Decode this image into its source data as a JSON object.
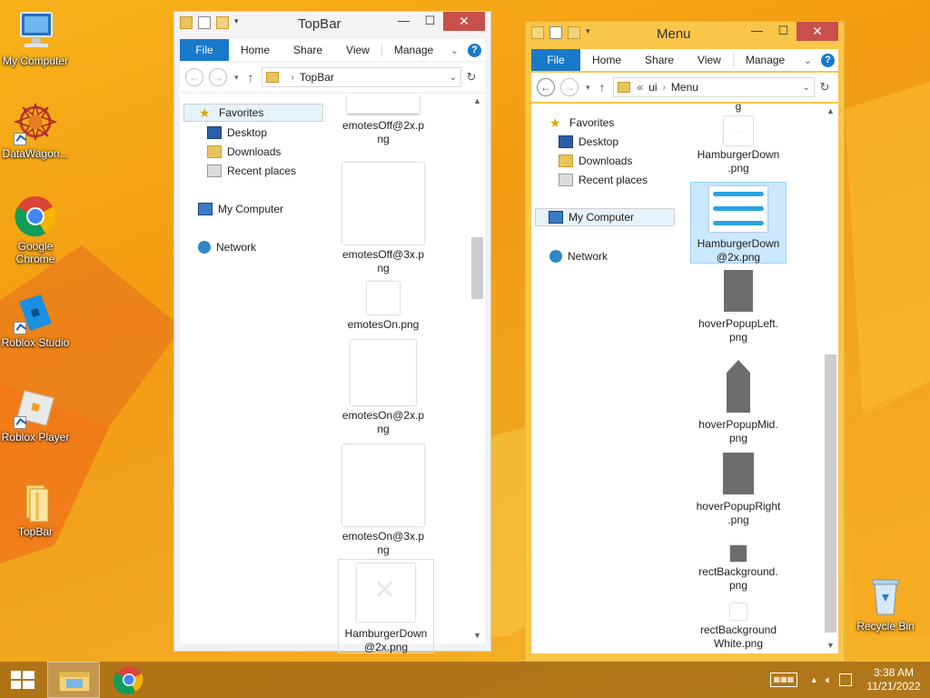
{
  "desktop": {
    "icons": [
      {
        "label": "My Computer"
      },
      {
        "label": "DataWagon..."
      },
      {
        "label": "Google Chrome"
      },
      {
        "label": "Roblox Studio"
      },
      {
        "label": "Roblox Player"
      },
      {
        "label": "TopBar"
      },
      {
        "label": "Recycle Bin"
      }
    ]
  },
  "left_window": {
    "title": "TopBar",
    "ribbon": {
      "file": "File",
      "tabs": [
        "Home",
        "Share",
        "View",
        "Manage"
      ]
    },
    "address": {
      "crumbs": [
        "TopBar"
      ]
    },
    "nav": {
      "favorites": "Favorites",
      "desktop": "Desktop",
      "downloads": "Downloads",
      "recent": "Recent places",
      "computer": "My Computer",
      "network": "Network"
    },
    "files": [
      {
        "name_line1": "emotesOff@2x.p",
        "name_line2": "ng"
      },
      {
        "name_line1": "emotesOff@3x.p",
        "name_line2": "ng"
      },
      {
        "name_line1": "emotesOn.png",
        "name_line2": ""
      },
      {
        "name_line1": "emotesOn@2x.p",
        "name_line2": "ng"
      },
      {
        "name_line1": "emotesOn@3x.p",
        "name_line2": "ng"
      },
      {
        "name_line1": "HamburgerDown",
        "name_line2": "@2x.png"
      }
    ]
  },
  "right_window": {
    "title": "Menu",
    "ribbon": {
      "file": "File",
      "tabs": [
        "Home",
        "Share",
        "View",
        "Manage"
      ]
    },
    "address": {
      "prefix": "«",
      "crumbs": [
        "ui",
        "Menu"
      ]
    },
    "nav": {
      "favorites": "Favorites",
      "desktop": "Desktop",
      "downloads": "Downloads",
      "recent": "Recent places",
      "computer": "My Computer",
      "network": "Network"
    },
    "top_partial": "g",
    "files": [
      {
        "name_line1": "HamburgerDown",
        "name_line2": ".png"
      },
      {
        "name_line1": "HamburgerDown",
        "name_line2": "@2x.png"
      },
      {
        "name_line1": "hoverPopupLeft.",
        "name_line2": "png"
      },
      {
        "name_line1": "hoverPopupMid.",
        "name_line2": "png"
      },
      {
        "name_line1": "hoverPopupRight",
        "name_line2": ".png"
      },
      {
        "name_line1": "rectBackground.",
        "name_line2": "png"
      },
      {
        "name_line1": "rectBackground",
        "name_line2": "White.png"
      }
    ]
  },
  "taskbar": {
    "time": "3:38 AM",
    "date": "11/21/2022"
  },
  "colors": {
    "accent": "#1979ca",
    "close": "#c7504a",
    "selection": "#cce8ff",
    "active_frame": "#f9c64a"
  }
}
